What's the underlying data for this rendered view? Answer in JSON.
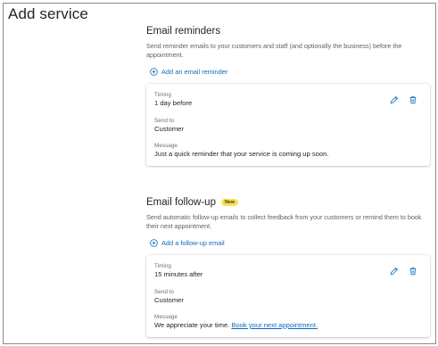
{
  "page": {
    "title": "Add service"
  },
  "reminders": {
    "title": "Email reminders",
    "description": "Send reminder emails to your customers and staff (and optionally the business) before the appointment.",
    "add_label": "Add an email reminder",
    "card": {
      "timing_label": "Timing",
      "timing_value": "1 day before",
      "send_to_label": "Send to",
      "send_to_value": "Customer",
      "message_label": "Message",
      "message_value": "Just a quick reminder that your service is coming up soon."
    }
  },
  "followup": {
    "title": "Email follow-up",
    "badge": "New",
    "description": "Send automatic follow-up emails to collect feedback from your customers or remind them to book their next appointment.",
    "add_label": "Add a follow-up email",
    "card": {
      "timing_label": "Timing",
      "timing_value": "15 minutes after",
      "send_to_label": "Send to",
      "send_to_value": "Customer",
      "message_label": "Message",
      "message_text": "We appreciate your time.",
      "message_link": "Book your next appointment."
    }
  },
  "icons": {
    "add": "plus-circle-icon",
    "edit": "pencil-icon",
    "delete": "trash-icon"
  },
  "colors": {
    "accent": "#0f6cbd",
    "badge": "#f7e15e",
    "text": "#242424",
    "muted": "#616161"
  }
}
